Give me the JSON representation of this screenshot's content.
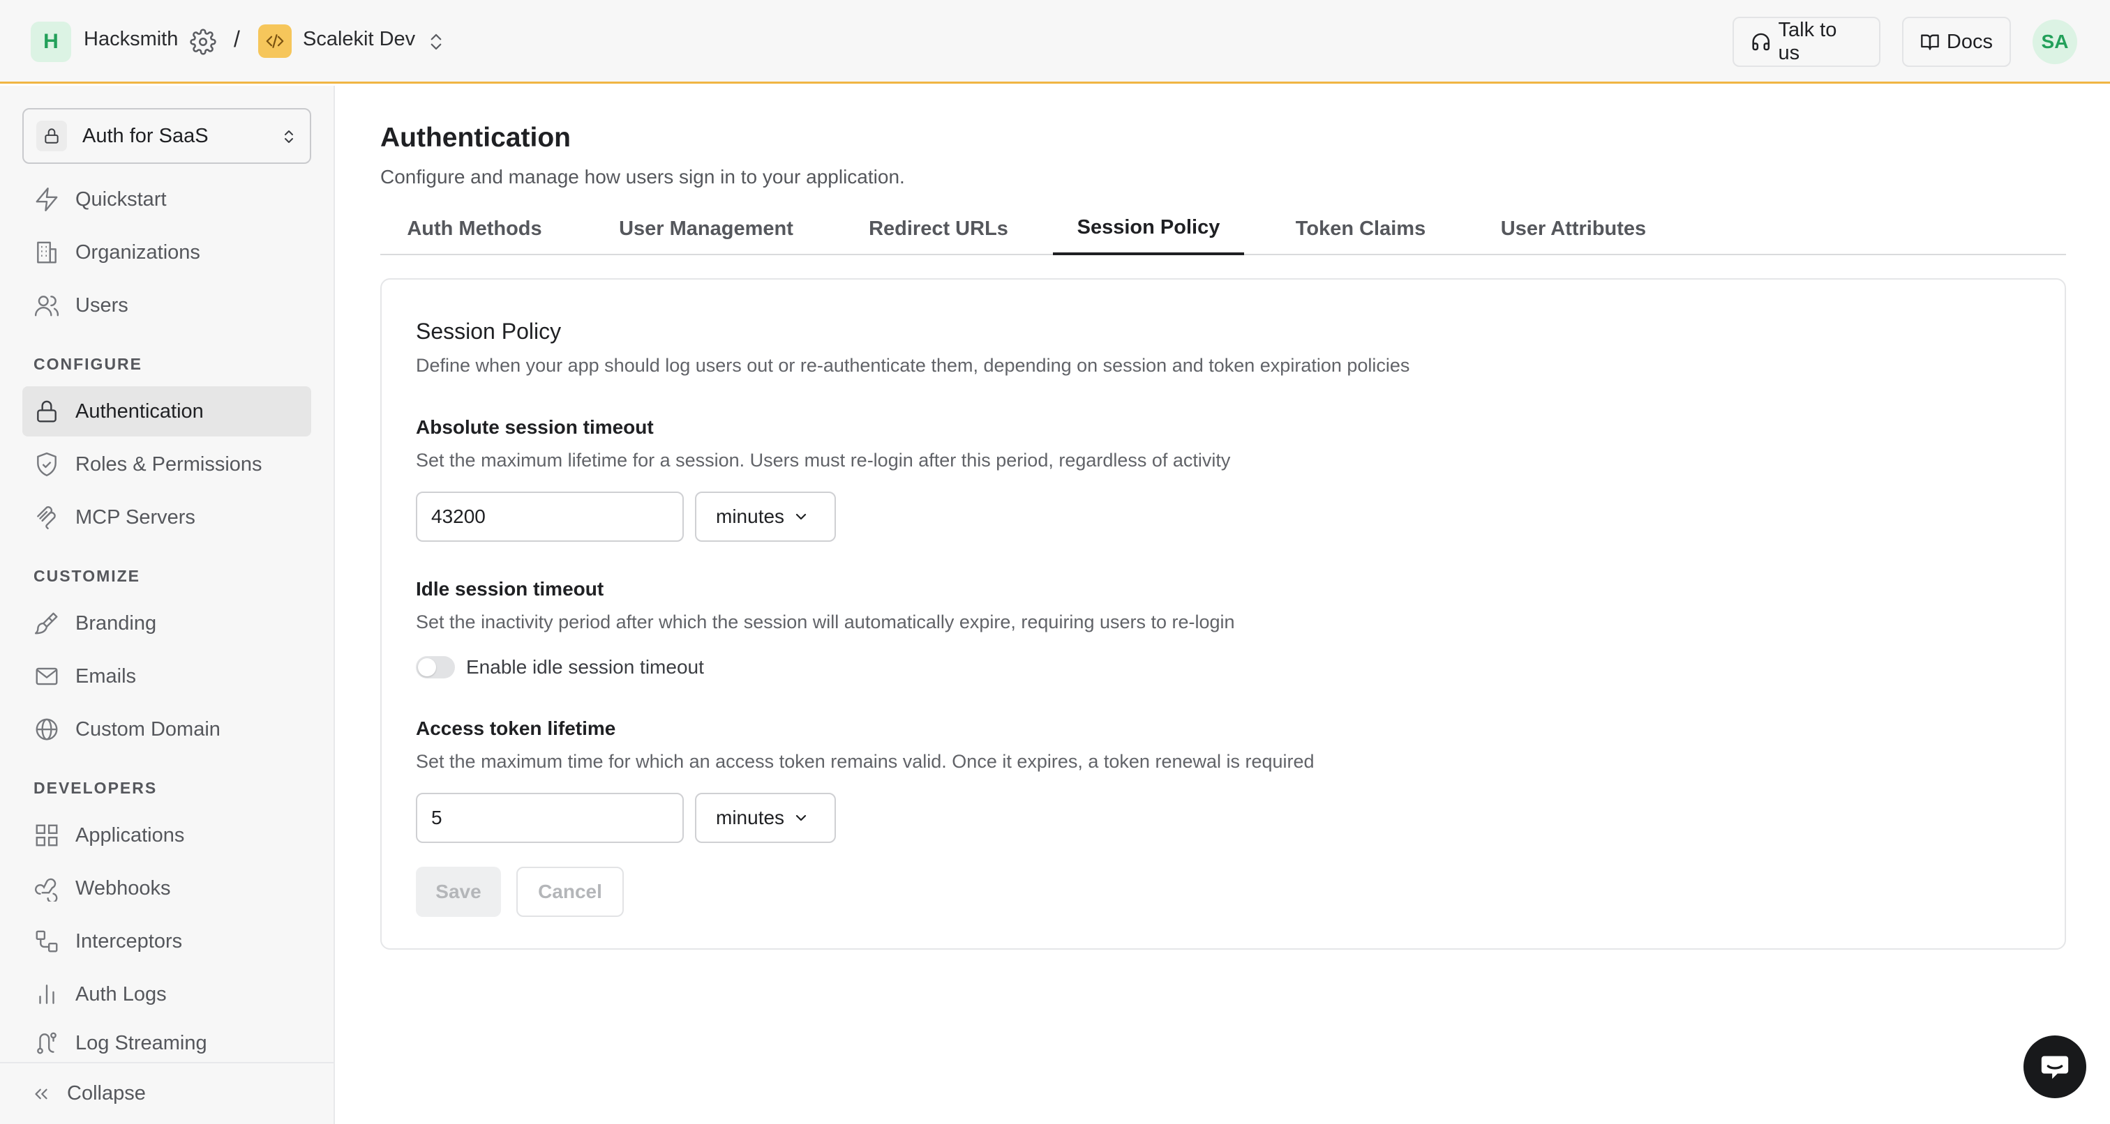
{
  "topbar": {
    "workspace_initial": "H",
    "workspace_name": "Hacksmith",
    "separator": "/",
    "environment_name": "Scalekit Dev",
    "talk_label": "Talk to us",
    "docs_label": "Docs",
    "user_initials": "SA",
    "accent_color": "#f0b544"
  },
  "sidebar": {
    "product_select": "Auth for SaaS",
    "items_top": [
      {
        "label": "Quickstart",
        "icon": "lightning-icon"
      },
      {
        "label": "Organizations",
        "icon": "building-icon"
      },
      {
        "label": "Users",
        "icon": "users-icon"
      }
    ],
    "section_configure": "CONFIGURE",
    "items_configure": [
      {
        "label": "Authentication",
        "icon": "lock-icon",
        "active": true
      },
      {
        "label": "Roles & Permissions",
        "icon": "shield-check-icon"
      },
      {
        "label": "MCP Servers",
        "icon": "mcp-icon"
      }
    ],
    "section_customize": "CUSTOMIZE",
    "items_customize": [
      {
        "label": "Branding",
        "icon": "paintbrush-icon"
      },
      {
        "label": "Emails",
        "icon": "mail-icon"
      },
      {
        "label": "Custom Domain",
        "icon": "globe-icon"
      }
    ],
    "section_developers": "DEVELOPERS",
    "items_developers": [
      {
        "label": "Applications",
        "icon": "grid-icon"
      },
      {
        "label": "Webhooks",
        "icon": "webhook-icon"
      },
      {
        "label": "Interceptors",
        "icon": "interceptor-icon"
      },
      {
        "label": "Auth Logs",
        "icon": "bar-chart-icon"
      },
      {
        "label": "Log Streaming",
        "icon": "route-icon"
      }
    ],
    "collapse_label": "Collapse"
  },
  "main": {
    "title": "Authentication",
    "subtitle": "Configure and manage how users sign in to your application.",
    "tabs": [
      {
        "label": "Auth Methods"
      },
      {
        "label": "User Management"
      },
      {
        "label": "Redirect URLs"
      },
      {
        "label": "Session Policy",
        "active": true
      },
      {
        "label": "Token Claims"
      },
      {
        "label": "User Attributes"
      }
    ]
  },
  "session_policy": {
    "title": "Session Policy",
    "description": "Define when your app should log users out or re-authenticate them, depending on session and token expiration policies",
    "absolute": {
      "label": "Absolute session timeout",
      "help": "Set the maximum lifetime for a session. Users must re-login after this period, regardless of activity",
      "value": "43200",
      "unit": "minutes"
    },
    "idle": {
      "label": "Idle session timeout",
      "help": "Set the inactivity period after which the session will automatically expire, requiring users to re-login",
      "toggle_label": "Enable idle session timeout",
      "enabled": false
    },
    "access_token": {
      "label": "Access token lifetime",
      "help": "Set the maximum time for which an access token remains valid. Once it expires, a token renewal is required",
      "value": "5",
      "unit": "minutes"
    },
    "save_label": "Save",
    "cancel_label": "Cancel"
  }
}
